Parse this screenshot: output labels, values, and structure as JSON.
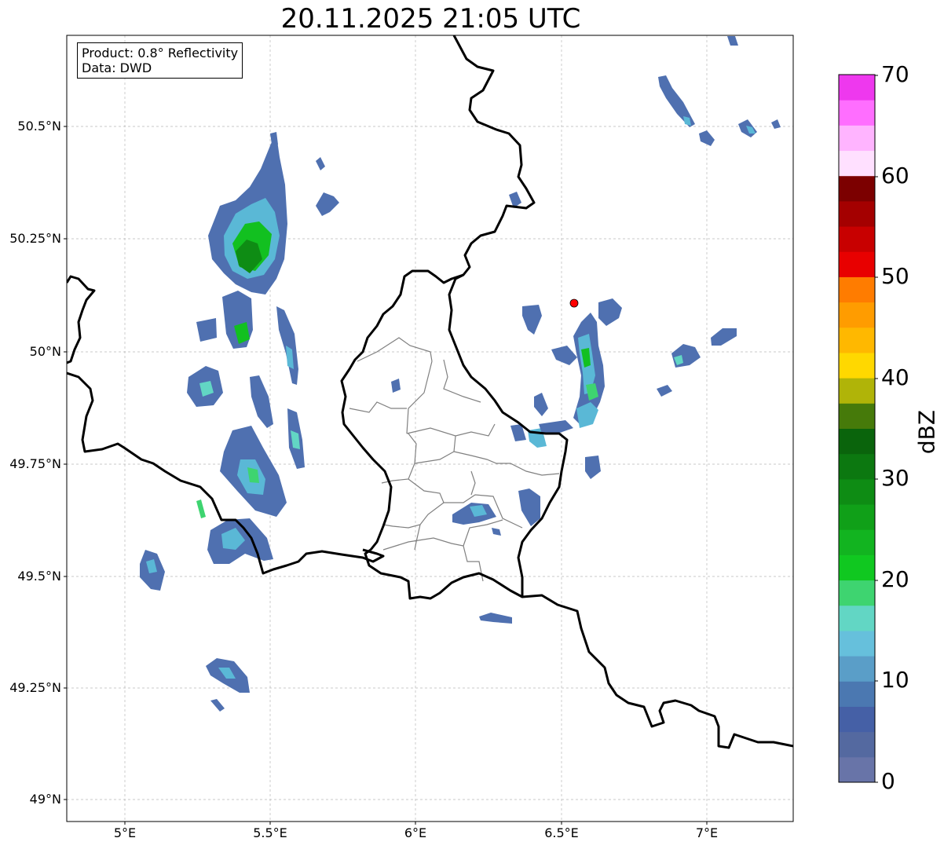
{
  "title": "20.11.2025 21:05 UTC",
  "infobox": {
    "product": "Product: 0.8° Reflectivity",
    "data": "Data: DWD"
  },
  "axes": {
    "x_ticks": [
      "5°E",
      "5.5°E",
      "6°E",
      "6.5°E",
      "7°E"
    ],
    "y_ticks": [
      "50.5°N",
      "50.25°N",
      "50°N",
      "49.75°N",
      "49.5°N",
      "49.25°N",
      "49°N"
    ],
    "lon_range": [
      4.8,
      7.3
    ],
    "lat_range": [
      48.95,
      50.7
    ],
    "grid": true
  },
  "colorbar": {
    "label": "dBZ",
    "ticks": [
      "0",
      "10",
      "20",
      "30",
      "40",
      "50",
      "60",
      "70"
    ],
    "range": [
      0,
      70
    ],
    "colors": [
      "#6874a8",
      "#5469a0",
      "#4560a6",
      "#4b78b1",
      "#5a9ec8",
      "#66c0dc",
      "#62d6c4",
      "#3ed470",
      "#10c820",
      "#12b420",
      "#10a018",
      "#0e8c14",
      "#0c7810",
      "#0a640c",
      "#467a0a",
      "#b0b408",
      "#ffd800",
      "#ffb800",
      "#ff9c00",
      "#ff7c00",
      "#e80000",
      "#c80000",
      "#a40000",
      "#7c0000",
      "#ffe0ff",
      "#ffb4ff",
      "#ff6eff",
      "#ee38ee"
    ]
  },
  "marker": {
    "lon": 6.54,
    "lat": 50.11,
    "color": "#ff0000"
  },
  "radar_colors": {
    "low": "#4f70b0",
    "mid": "#5ab8d6",
    "teal": "#62d6c4",
    "green": "#12c020",
    "dark_green": "#0e8c14"
  }
}
